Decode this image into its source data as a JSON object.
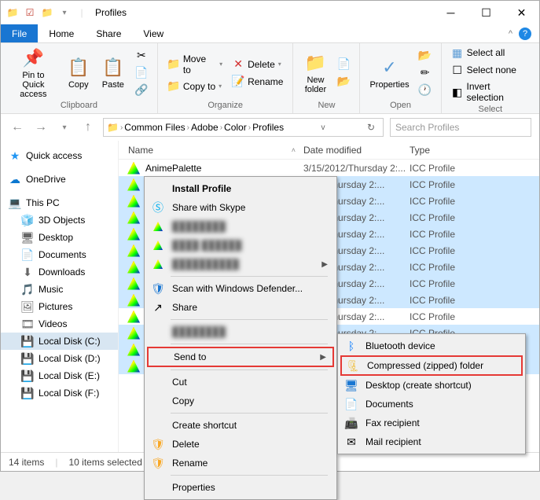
{
  "window": {
    "title": "Profiles"
  },
  "ribbon_tabs": {
    "file": "File",
    "home": "Home",
    "share": "Share",
    "view": "View"
  },
  "ribbon": {
    "clipboard": {
      "label": "Clipboard",
      "pin": "Pin to Quick\naccess",
      "copy": "Copy",
      "paste": "Paste"
    },
    "organize": {
      "label": "Organize",
      "moveto": "Move to",
      "copyto": "Copy to",
      "delete": "Delete",
      "rename": "Rename"
    },
    "new": {
      "label": "New",
      "newfolder": "New\nfolder"
    },
    "open": {
      "label": "Open",
      "properties": "Properties"
    },
    "select": {
      "label": "Select",
      "all": "Select all",
      "none": "Select none",
      "invert": "Invert selection"
    }
  },
  "breadcrumb": {
    "segs": [
      "Common Files",
      "Adobe",
      "Color",
      "Profiles"
    ]
  },
  "search": {
    "placeholder": "Search Profiles"
  },
  "sidebar": {
    "items": [
      {
        "icon": "★",
        "label": "Quick access",
        "color": "#2196f3"
      },
      {
        "icon": "☁",
        "label": "OneDrive",
        "color": "#0b77cf"
      },
      {
        "icon": "💻",
        "label": "This PC",
        "color": "#1976d2"
      },
      {
        "icon": "🧊",
        "label": "3D Objects",
        "sub": true
      },
      {
        "icon": "🖥",
        "label": "Desktop",
        "sub": true
      },
      {
        "icon": "📄",
        "label": "Documents",
        "sub": true
      },
      {
        "icon": "⬇",
        "label": "Downloads",
        "sub": true
      },
      {
        "icon": "🎵",
        "label": "Music",
        "sub": true
      },
      {
        "icon": "🖼",
        "label": "Pictures",
        "sub": true
      },
      {
        "icon": "🎞",
        "label": "Videos",
        "sub": true
      },
      {
        "icon": "💾",
        "label": "Local Disk (C:)",
        "sub": true,
        "selected": true
      },
      {
        "icon": "💾",
        "label": "Local Disk (D:)",
        "sub": true
      },
      {
        "icon": "💾",
        "label": "Local Disk (E:)",
        "sub": true
      },
      {
        "icon": "💾",
        "label": "Local Disk (F:)",
        "sub": true
      }
    ]
  },
  "columns": {
    "name": "Name",
    "date": "Date modified",
    "type": "Type"
  },
  "files": [
    {
      "name": "AnimePalette",
      "date": "3/15/2012/Thursday 2:...",
      "type": "ICC Profile",
      "sel": false
    },
    {
      "name": "",
      "date": "2012/Thursday 2:...",
      "type": "ICC Profile",
      "sel": true,
      "blur": true
    },
    {
      "name": "",
      "date": "2012/Thursday 2:...",
      "type": "ICC Profile",
      "sel": true,
      "blur": true
    },
    {
      "name": "",
      "date": "2012/Thursday 2:...",
      "type": "ICC Profile",
      "sel": true,
      "blur": true
    },
    {
      "name": "",
      "date": "2012/Thursday 2:...",
      "type": "ICC Profile",
      "sel": true,
      "blur": true
    },
    {
      "name": "",
      "date": "2012/Thursday 2:...",
      "type": "ICC Profile",
      "sel": true,
      "blur": true
    },
    {
      "name": "",
      "date": "2012/Thursday 2:...",
      "type": "ICC Profile",
      "sel": true,
      "blur": true
    },
    {
      "name": "",
      "date": "2012/Thursday 2:...",
      "type": "ICC Profile",
      "sel": true,
      "blur": true
    },
    {
      "name": "",
      "date": "2012/Thursday 2:...",
      "type": "ICC Profile",
      "sel": true,
      "blur": true
    },
    {
      "name": "",
      "date": "2012/Thursday 2:...",
      "type": "ICC Profile",
      "sel": false,
      "blur": true
    },
    {
      "name": "",
      "date": "2012/Thursday 2:...",
      "type": "ICC Profile",
      "sel": true,
      "blur": true
    },
    {
      "name": "",
      "date": "",
      "type": "",
      "sel": true,
      "blur": true
    },
    {
      "name": "",
      "date": "",
      "type": "",
      "sel": true,
      "blur": true
    }
  ],
  "status": {
    "items": "14 items",
    "selected": "10 items selected"
  },
  "ctx1": {
    "install": "Install Profile",
    "skype": "Share with Skype",
    "blur1": "████████",
    "blur2": "████ ██████",
    "blur3": "██████████",
    "defender": "Scan with Windows Defender...",
    "share": "Share",
    "blur4": "████████",
    "sendto": "Send to",
    "cut": "Cut",
    "copy": "Copy",
    "shortcut": "Create shortcut",
    "delete": "Delete",
    "rename": "Rename",
    "properties": "Properties"
  },
  "ctx2": {
    "bluetooth": "Bluetooth device",
    "zip": "Compressed (zipped) folder",
    "desktop": "Desktop (create shortcut)",
    "documents": "Documents",
    "fax": "Fax recipient",
    "mail": "Mail recipient"
  }
}
